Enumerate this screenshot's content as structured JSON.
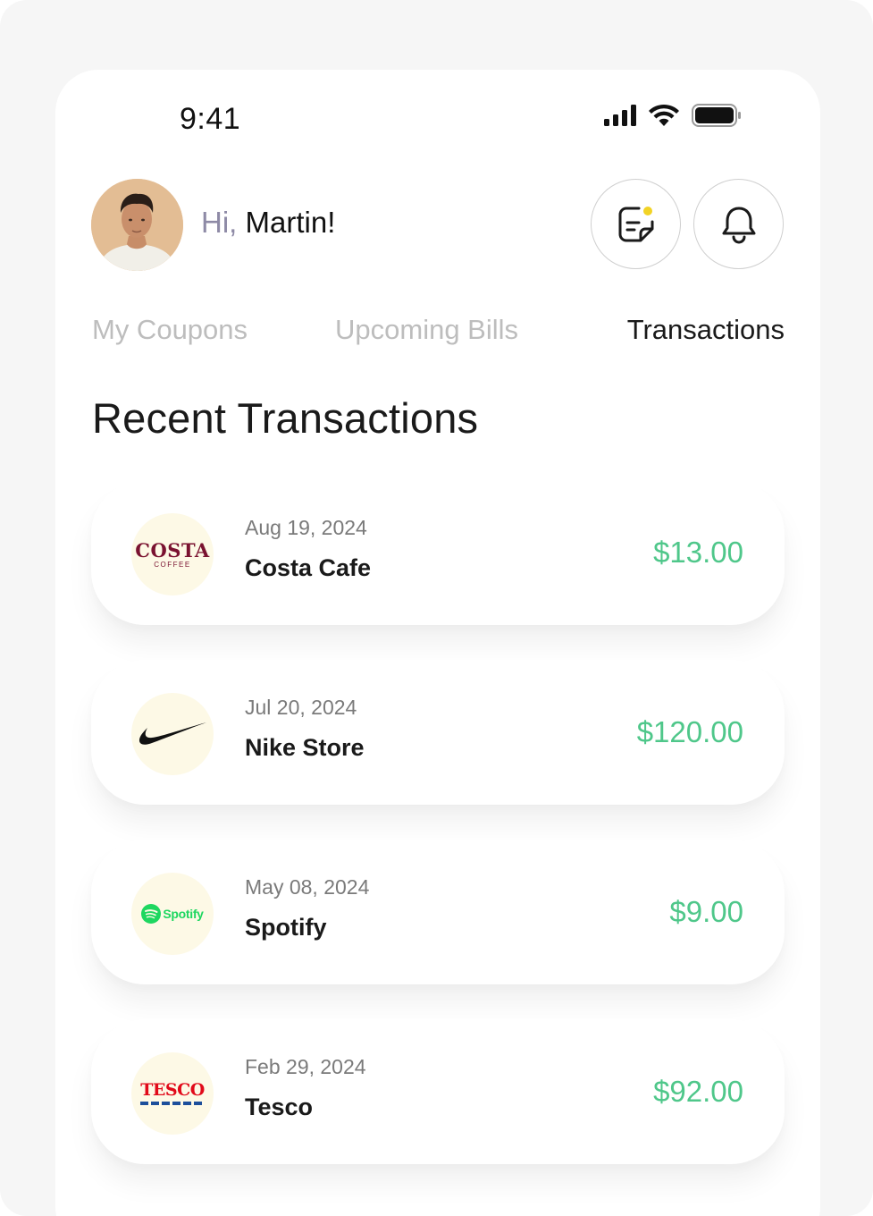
{
  "status_bar": {
    "time": "9:41"
  },
  "header": {
    "greeting_hi": "Hi,",
    "greeting_name": "Martin!",
    "notes_button_icon": "notes-icon",
    "bell_button_icon": "bell-icon",
    "notes_badge_color": "#f2d325"
  },
  "tabs": [
    {
      "label": "My Coupons",
      "active": false
    },
    {
      "label": "Upcoming Bills",
      "active": false
    },
    {
      "label": "Transactions",
      "active": true
    }
  ],
  "section_title": "Recent Transactions",
  "transactions": [
    {
      "date": "Aug 19, 2024",
      "merchant": "Costa Cafe",
      "amount": "$13.00",
      "logo_text": "COSTA",
      "logo_subtext": "COFFEE",
      "logo_color": "#7a1230"
    },
    {
      "date": "Jul 20, 2024",
      "merchant": "Nike Store",
      "amount": "$120.00",
      "logo_icon": "nike-swoosh-icon",
      "logo_color": "#111111"
    },
    {
      "date": "May 08, 2024",
      "merchant": "Spotify",
      "amount": "$9.00",
      "logo_text": "Spotify",
      "logo_color": "#1ed760"
    },
    {
      "date": "Feb 29, 2024",
      "merchant": "Tesco",
      "amount": "$92.00",
      "logo_text": "TESCO",
      "logo_color": "#e10a1a",
      "logo_stripe_color": "#1d4f9b"
    }
  ],
  "colors": {
    "amount_positive": "#4fc78a",
    "tab_active": "#1a1a1a",
    "tab_inactive": "#bdbdbd",
    "logo_background": "#fdf9e6"
  }
}
